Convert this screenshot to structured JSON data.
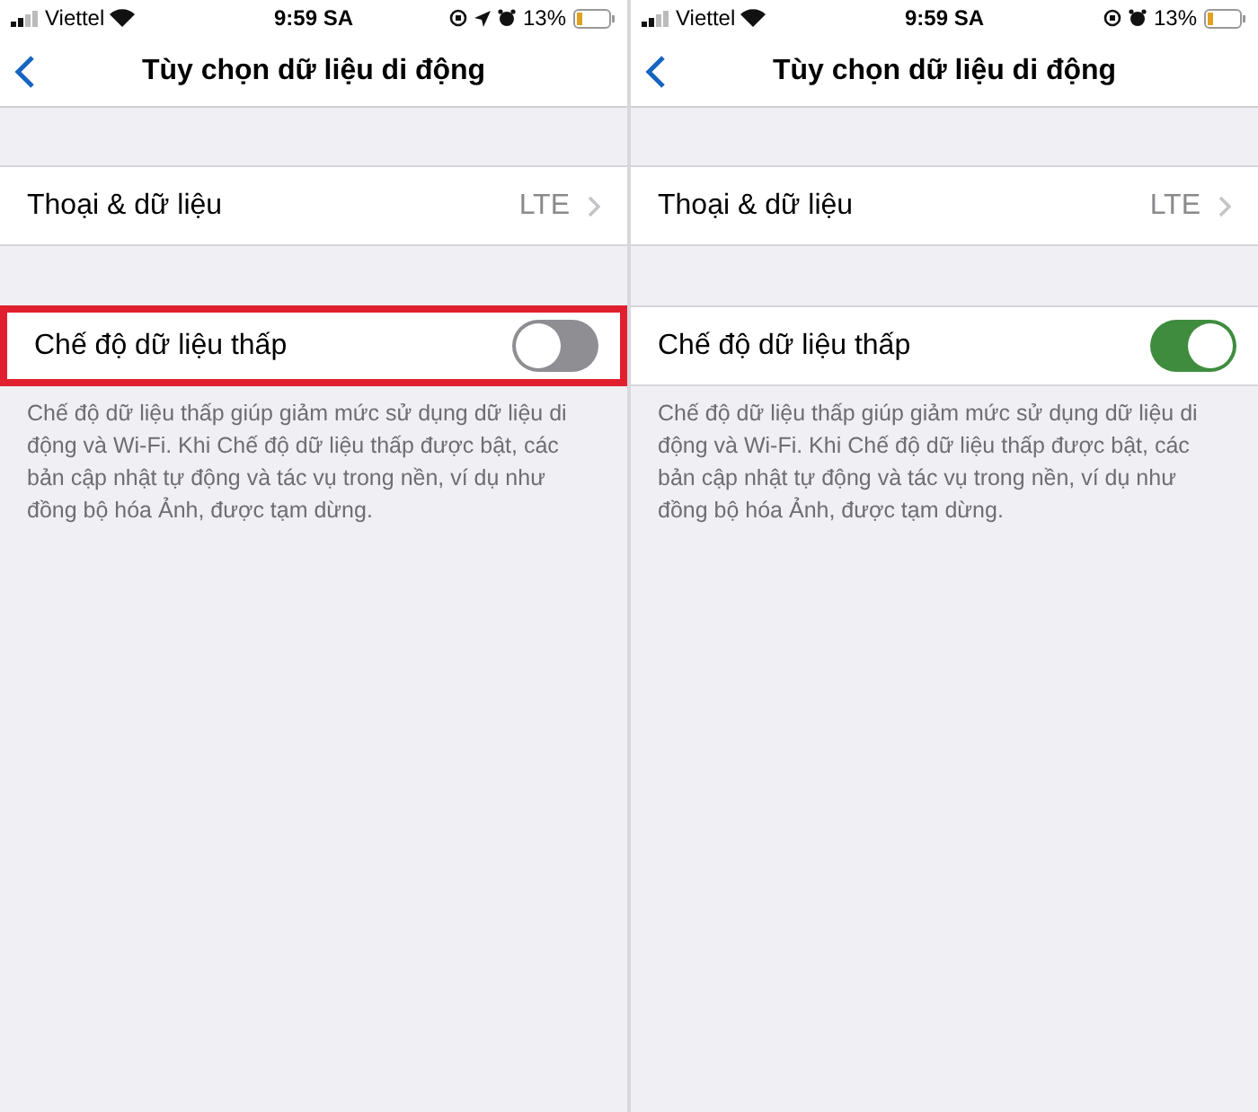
{
  "panels": [
    {
      "status": {
        "carrier": "Viettel",
        "time": "9:59 SA",
        "battery": "13%",
        "location": true
      },
      "title": "Tùy chọn dữ liệu di động",
      "cellular_row": {
        "label": "Thoại & dữ liệu",
        "value": "LTE"
      },
      "low_data_row": {
        "label": "Chế độ dữ liệu thấp",
        "on": false,
        "highlighted": true
      },
      "footer": "Chế độ dữ liệu thấp giúp giảm mức sử dụng dữ liệu di động và Wi-Fi. Khi Chế độ dữ liệu thấp được bật, các bản cập nhật tự động và tác vụ trong nền, ví dụ như đồng bộ hóa Ảnh, được tạm dừng."
    },
    {
      "status": {
        "carrier": "Viettel",
        "time": "9:59 SA",
        "battery": "13%",
        "location": false
      },
      "title": "Tùy chọn dữ liệu di động",
      "cellular_row": {
        "label": "Thoại & dữ liệu",
        "value": "LTE"
      },
      "low_data_row": {
        "label": "Chế độ dữ liệu thấp",
        "on": true,
        "highlighted": false
      },
      "footer": "Chế độ dữ liệu thấp giúp giảm mức sử dụng dữ liệu di động và Wi-Fi. Khi Chế độ dữ liệu thấp được bật, các bản cập nhật tự động và tác vụ trong nền, ví dụ như đồng bộ hóa Ảnh, được tạm dừng."
    }
  ]
}
